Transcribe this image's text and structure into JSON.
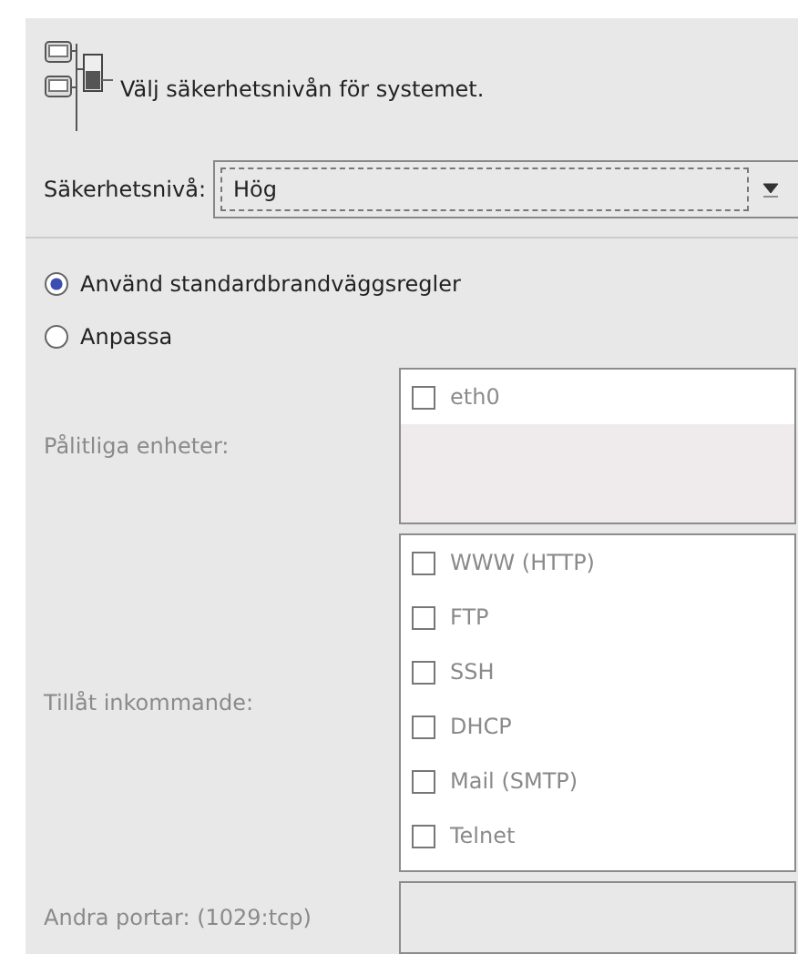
{
  "header": {
    "title": "Välj säkerhetsnivån för systemet."
  },
  "security_level": {
    "label": "Säkerhetsnivå:",
    "value": "Hög"
  },
  "rule_options": [
    {
      "label": "Använd standardbrandväggsregler",
      "selected": true
    },
    {
      "label": "Anpassa",
      "selected": false
    }
  ],
  "custom": {
    "disabled": true,
    "trusted_devices": {
      "label": "Pålitliga enheter:",
      "items": [
        {
          "label": "eth0",
          "checked": false
        }
      ]
    },
    "allow_incoming": {
      "label": "Tillåt inkommande:",
      "items": [
        {
          "label": "WWW (HTTP)",
          "checked": false
        },
        {
          "label": "FTP",
          "checked": false
        },
        {
          "label": "SSH",
          "checked": false
        },
        {
          "label": "DHCP",
          "checked": false
        },
        {
          "label": "Mail (SMTP)",
          "checked": false
        },
        {
          "label": "Telnet",
          "checked": false
        }
      ]
    },
    "other_ports": {
      "label": "Andra portar: (1029:tcp)"
    }
  }
}
